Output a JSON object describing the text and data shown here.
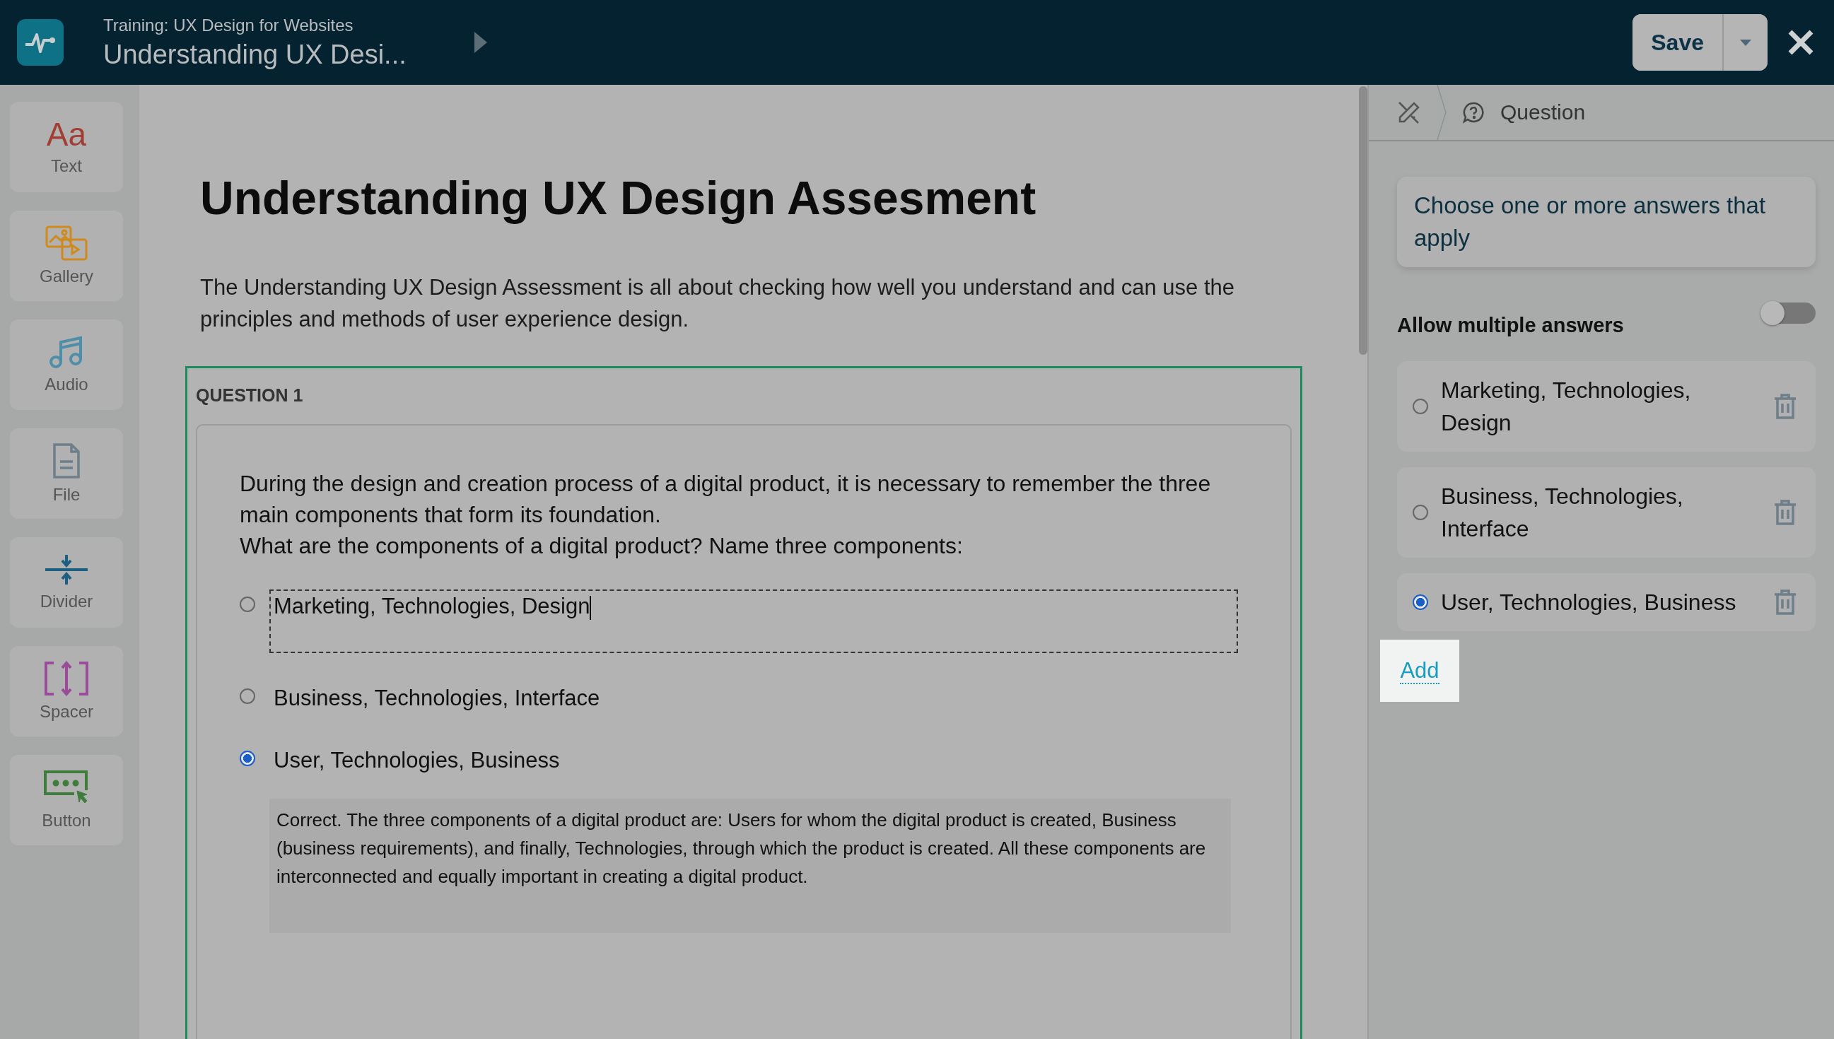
{
  "header": {
    "course": "Training: UX Design for Websites",
    "title": "Understanding UX Desi..."
  },
  "actions": {
    "save": "Save"
  },
  "tools": [
    {
      "kind": "text",
      "glyph": "Aa",
      "label": "Text"
    },
    {
      "kind": "gallery",
      "label": "Gallery"
    },
    {
      "kind": "audio",
      "label": "Audio"
    },
    {
      "kind": "file",
      "label": "File"
    },
    {
      "kind": "divider",
      "label": "Divider"
    },
    {
      "kind": "spacer",
      "label": "Spacer"
    },
    {
      "kind": "button",
      "label": "Button"
    }
  ],
  "document": {
    "title": "Understanding UX Design Assesment",
    "intro": "The Understanding UX Design Assessment is all about checking how well you understand and can use the principles and methods of user experience design.",
    "question": {
      "label": "QUESTION 1",
      "prompt": [
        "During the design and creation process of a digital product, it is necessary to remember the three main components that form its foundation.",
        "What are the components of a digital product? Name three components:"
      ],
      "options": [
        {
          "text": "Marketing, Technologies, Design",
          "selected": false,
          "editing": true
        },
        {
          "text": "Business, Technologies, Interface",
          "selected": false,
          "editing": false
        },
        {
          "text": "User, Technologies, Business",
          "selected": true,
          "editing": false
        }
      ],
      "feedback": "Correct. The three components of a digital product are: Users for whom the digital product is created, Business (business requirements), and finally, Technologies, through which the product is created. All these components are interconnected and equally important in creating a digital product."
    }
  },
  "panel": {
    "breadcrumb": "Question",
    "instruction": "Choose one or more answers that apply",
    "toggle": {
      "label": "Allow multiple answers",
      "on": false
    },
    "answers": [
      {
        "text": "Marketing, Technologies, Design",
        "selected": false
      },
      {
        "text": "Business, Technologies, Interface",
        "selected": false
      },
      {
        "text": "User, Technologies, Business",
        "selected": true
      }
    ],
    "add": "Add"
  }
}
